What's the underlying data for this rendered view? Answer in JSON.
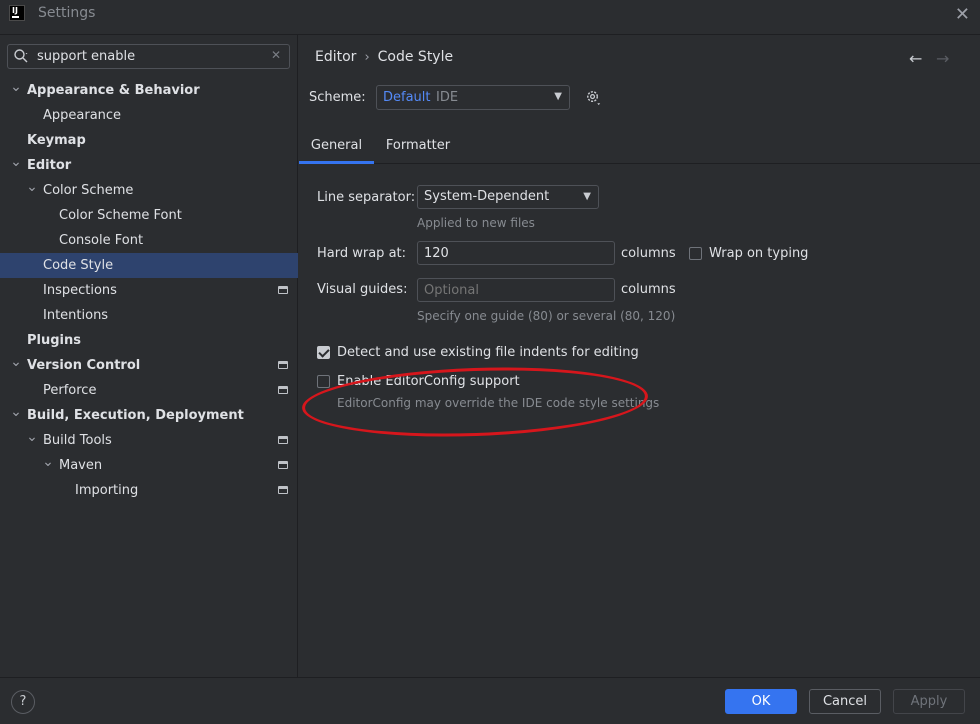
{
  "window": {
    "title": "Settings"
  },
  "search": {
    "value": "support enable",
    "placeholder": ""
  },
  "tree": [
    {
      "label": "Appearance & Behavior",
      "expanded": true,
      "bold": true
    },
    {
      "label": "Appearance"
    },
    {
      "label": "Keymap",
      "bold": true
    },
    {
      "label": "Editor",
      "expanded": true,
      "bold": true
    },
    {
      "label": "Color Scheme",
      "expanded": true
    },
    {
      "label": "Color Scheme Font"
    },
    {
      "label": "Console Font"
    },
    {
      "label": "Code Style",
      "selected": true
    },
    {
      "label": "Inspections",
      "badge": true
    },
    {
      "label": "Intentions"
    },
    {
      "label": "Plugins",
      "bold": true
    },
    {
      "label": "Version Control",
      "expanded": true,
      "bold": true,
      "badge": true
    },
    {
      "label": "Perforce",
      "badge": true
    },
    {
      "label": "Build, Execution, Deployment",
      "expanded": true,
      "bold": true
    },
    {
      "label": "Build Tools",
      "expanded": true,
      "badge": true
    },
    {
      "label": "Maven",
      "expanded": true,
      "badge": true
    },
    {
      "label": "Importing",
      "badge": true
    }
  ],
  "breadcrumb": {
    "parent": "Editor",
    "sep": "›",
    "current": "Code Style"
  },
  "scheme": {
    "label": "Scheme:",
    "value": "Default",
    "sub": "IDE"
  },
  "tabs": [
    {
      "label": "General",
      "active": true
    },
    {
      "label": "Formatter"
    }
  ],
  "general": {
    "line_separator_label": "Line separator:",
    "line_separator_value": "System-Dependent",
    "line_separator_hint": "Applied to new files",
    "hard_wrap_label": "Hard wrap at:",
    "hard_wrap_value": "120",
    "hard_wrap_unit": "columns",
    "wrap_on_typing_label": "Wrap on typing",
    "wrap_on_typing_checked": false,
    "visual_guides_label": "Visual guides:",
    "visual_guides_placeholder": "Optional",
    "visual_guides_unit": "columns",
    "visual_guides_hint": "Specify one guide (80) or several (80, 120)",
    "detect_indents_label": "Detect and use existing file indents for editing",
    "detect_indents_checked": true,
    "editorconfig_label": "Enable EditorConfig support",
    "editorconfig_checked": false,
    "editorconfig_hint": "EditorConfig may override the IDE code style settings"
  },
  "buttons": {
    "help": "?",
    "ok": "OK",
    "cancel": "Cancel",
    "apply": "Apply"
  },
  "colors": {
    "accent": "#3574f0",
    "selection": "#2e436e",
    "annotation": "#d6161c"
  }
}
